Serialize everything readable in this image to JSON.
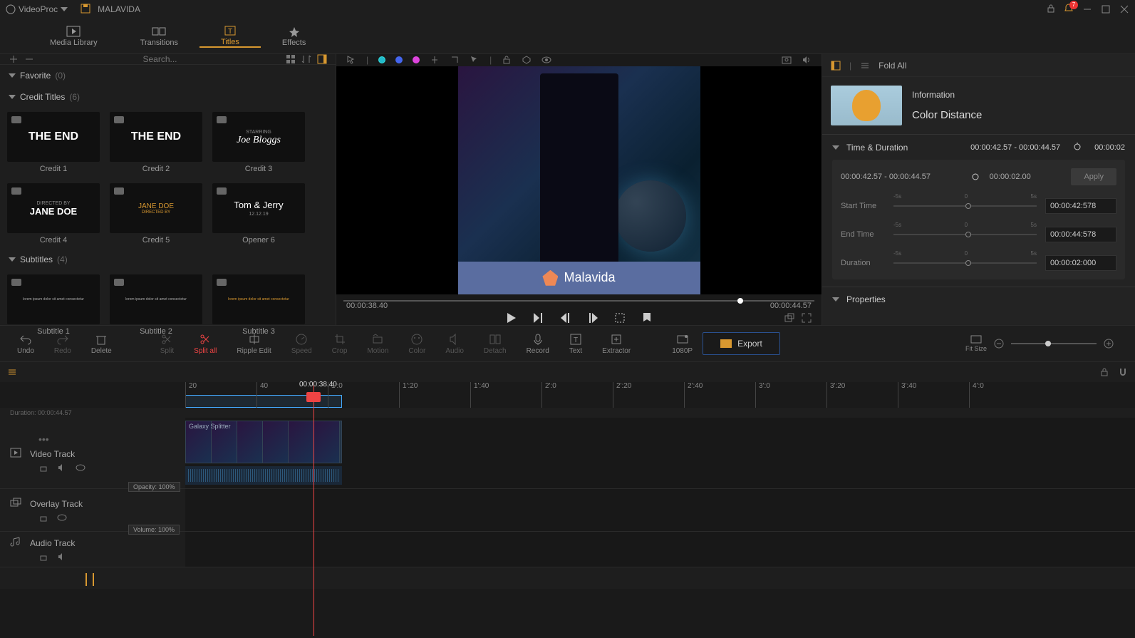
{
  "app": {
    "name": "VideoProc",
    "project": "MALAVIDA",
    "notifications": "7"
  },
  "nav": {
    "media": "Media Library",
    "transitions": "Transitions",
    "titles": "Titles",
    "effects": "Effects"
  },
  "search": {
    "placeholder": "Search..."
  },
  "categories": {
    "favorite": {
      "label": "Favorite",
      "count": "(0)"
    },
    "credits": {
      "label": "Credit Titles",
      "count": "(6)"
    },
    "subtitles": {
      "label": "Subtitles",
      "count": "(4)"
    }
  },
  "tiles": {
    "c1": {
      "label": "Credit 1",
      "text": "THE END"
    },
    "c2": {
      "label": "Credit 2",
      "text": "THE END"
    },
    "c3": {
      "label": "Credit 3",
      "sub": "STARRING",
      "text": "Joe Bloggs"
    },
    "c4": {
      "label": "Credit 4",
      "sub": "DIRECTED BY",
      "text": "JANE DOE"
    },
    "c5": {
      "label": "Credit 5",
      "text": "JANE DOE",
      "sub": "DIRECTED BY"
    },
    "c6": {
      "label": "Opener 6",
      "text": "Tom & Jerry",
      "sub": "12.12.19"
    },
    "s1": {
      "label": "Subtitle 1"
    },
    "s2": {
      "label": "Subtitle 2"
    },
    "s3": {
      "label": "Subtitle 3"
    }
  },
  "preview": {
    "brand": "Malavida",
    "time_current": "00:00:38.40",
    "time_total": "00:00:44.57"
  },
  "inspector": {
    "info_label": "Information",
    "title": "Color Distance",
    "time_section": "Time & Duration",
    "time_range": "00:00:42.57 - 00:00:44.57",
    "time_dur": "00:00:02",
    "box_range": "00:00:42.57 - 00:00:44.57",
    "box_dur": "00:00:02.00",
    "apply": "Apply",
    "start_label": "Start Time",
    "start_val": "00:00:42:578",
    "end_label": "End Time",
    "end_val": "00:00:44:578",
    "dur_label": "Duration",
    "dur_val": "00:00:02:000",
    "tick_l": "-5s",
    "tick_c": "0",
    "tick_r": "5s",
    "props": "Properties",
    "fold": "Fold All"
  },
  "tools": {
    "undo": "Undo",
    "redo": "Redo",
    "delete": "Delete",
    "split": "Split",
    "splitall": "Split all",
    "ripple": "Ripple Edit",
    "speed": "Speed",
    "crop": "Crop",
    "motion": "Motion",
    "color": "Color",
    "audio": "Audio",
    "detach": "Detach",
    "record": "Record",
    "text": "Text",
    "extractor": "Extractor",
    "quality": "1080P",
    "export": "Export",
    "fit": "Fit Size"
  },
  "timeline": {
    "playhead": "00:00:38.40",
    "duration_label": "Duration:",
    "duration_val": "00:00:44.57",
    "ticks": [
      "20",
      "40",
      "1':0",
      "1':20",
      "1':40",
      "2':0",
      "2':20",
      "2':40",
      "3':0",
      "3':20",
      "3':40",
      "4':0"
    ],
    "video_track": "Video Track",
    "overlay_track": "Overlay Track",
    "audio_track": "Audio Track",
    "clip_name": "Galaxy Splitter",
    "opacity": "Opacity: 100%",
    "volume": "Volume: 100%"
  }
}
